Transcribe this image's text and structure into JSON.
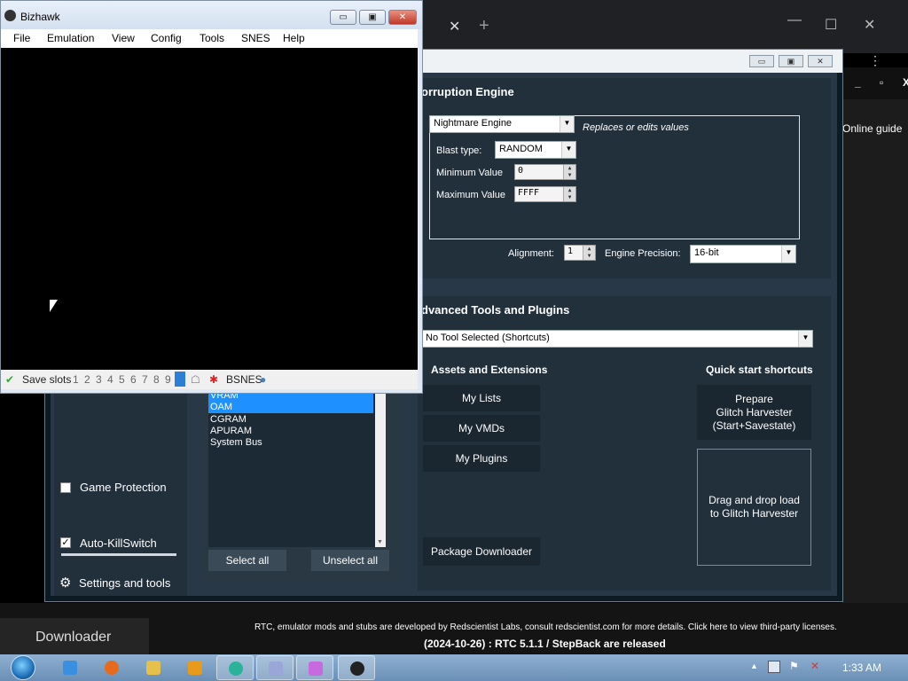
{
  "browser": {
    "tab_close": "✕",
    "new_tab": "+",
    "minimize": "—",
    "maximize": "☐",
    "close": "✕",
    "menu_dots": "⋮"
  },
  "helper": {
    "online_guide": "Online guide",
    "minimize": "_",
    "maximize": "▫",
    "close": "X"
  },
  "downloader": {
    "tab_label": "Downloader"
  },
  "footer": {
    "credits": "RTC, emulator mods and stubs are developed by Redscientist Labs, consult redscientist.com for more details. Click here to view third-party licenses.",
    "release": "(2024-10-26) : RTC 5.1.1 / StepBack are released"
  },
  "rtc": {
    "corruption_engine_header": "orruption Engine",
    "engine_select": "Nightmare Engine",
    "engine_desc": "Replaces or edits values",
    "blast_type_label": "Blast type:",
    "blast_type_value": "RANDOM",
    "min_value_label": "Minimum Value",
    "min_value": "0",
    "max_value_label": "Maximum Value",
    "max_value": "FFFF",
    "alignment_label": "Alignment:",
    "alignment_value": "1",
    "precision_label": "Engine Precision:",
    "precision_value": "16-bit",
    "advanced_header": "dvanced Tools and Plugins",
    "tool_select": "No Tool Selected (Shortcuts)",
    "assets_header": "Assets and Extensions",
    "quick_header": "Quick start shortcuts",
    "my_lists": "My Lists",
    "my_vmds": "My VMDs",
    "my_plugins": "My Plugins",
    "package_downloader": "Package Downloader",
    "prepare_harvester": "Prepare\nGlitch Harvester\n(Start+Savestate)",
    "drag_drop": "Drag and drop load\nto Glitch Harvester",
    "memory_domains": [
      "VRAM",
      "OAM",
      "CGRAM",
      "APURAM",
      "System Bus"
    ],
    "select_all": "Select all",
    "unselect_all": "Unselect all",
    "game_protection": "Game Protection",
    "auto_killswitch": "Auto-KillSwitch",
    "settings_tools": "Settings and tools"
  },
  "bizhawk": {
    "title": "Bizhawk",
    "minimize": "▭",
    "maximize": "▣",
    "close": "✕",
    "menu": [
      "File",
      "Emulation",
      "View",
      "Config",
      "Tools",
      "SNES",
      "Help"
    ],
    "save_slots_label": "Save slots",
    "slots": [
      "1",
      "2",
      "3",
      "4",
      "5",
      "6",
      "7",
      "8",
      "9"
    ],
    "core": "BSNES"
  },
  "taskbar": {
    "time": "1:33 AM",
    "apps": [
      "internet-explorer",
      "firefox",
      "file-explorer",
      "media-player",
      "chat-app",
      "emulator-app",
      "rtc-app",
      "bizhawk"
    ]
  }
}
